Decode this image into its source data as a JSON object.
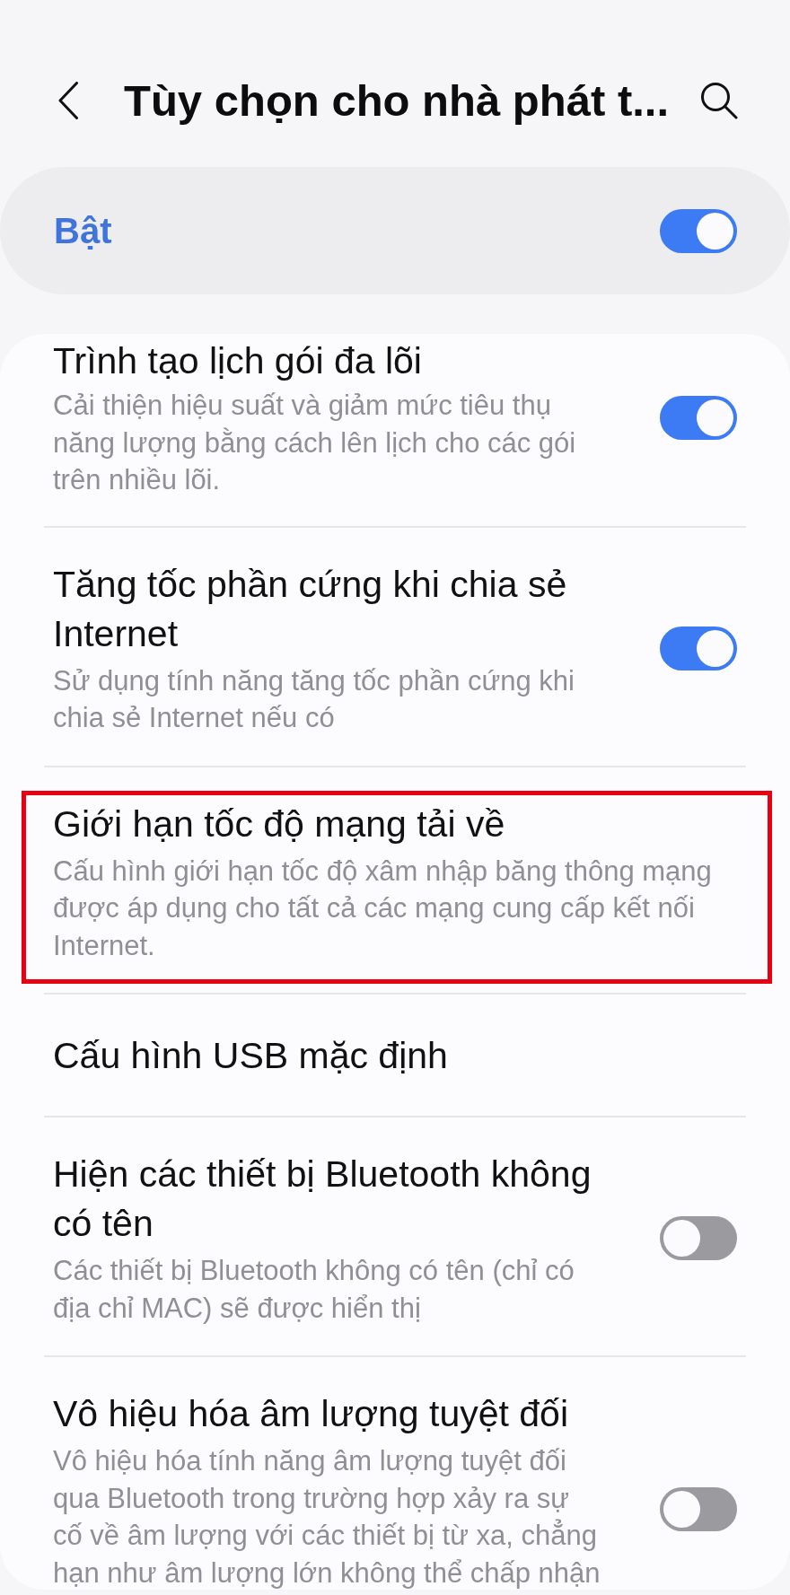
{
  "header": {
    "title": "Tùy chọn cho nhà phát t..."
  },
  "master_switch": {
    "label": "Bật",
    "on": true
  },
  "items": [
    {
      "kind": "toggle",
      "title": "Trình tạo lịch gói đa lõi",
      "description": [
        "Cải thiện hiệu suất và giảm mức tiêu thụ",
        "năng lượng bằng cách lên lịch cho các gói",
        "trên nhiều lõi."
      ],
      "on": true,
      "highlighted": false
    },
    {
      "kind": "toggle",
      "title": "Tăng tốc phần cứng khi chia sẻ Internet",
      "description": [
        "Sử dụng tính năng tăng tốc phần cứng khi",
        "chia sẻ Internet nếu có"
      ],
      "on": true,
      "highlighted": false
    },
    {
      "kind": "plain",
      "title": "Giới hạn tốc độ mạng tải về",
      "description": [
        "Cấu hình giới hạn tốc độ xâm nhập băng thông mạng",
        "được áp dụng cho tất cả các mạng cung cấp kết nối",
        "Internet."
      ],
      "highlighted": true
    },
    {
      "kind": "plain",
      "title": "Cấu hình USB mặc định",
      "highlighted": false
    },
    {
      "kind": "toggle",
      "title": "Hiện các thiết bị Bluetooth không có tên",
      "description": [
        "Các thiết bị Bluetooth không có tên (chỉ có",
        "địa chỉ MAC) sẽ được hiển thị"
      ],
      "on": false,
      "highlighted": false
    },
    {
      "kind": "toggle",
      "title": "Vô hiệu hóa âm lượng tuyệt đối",
      "description": [
        "Vô hiệu hóa tính năng âm lượng tuyệt đối",
        "qua Bluetooth trong trường hợp xảy ra sự",
        "cố về âm lượng với các thiết bị từ xa, chẳng",
        "hạn như âm lượng lớn không thể chấp nhận"
      ],
      "on": false,
      "highlighted": false
    }
  ]
}
